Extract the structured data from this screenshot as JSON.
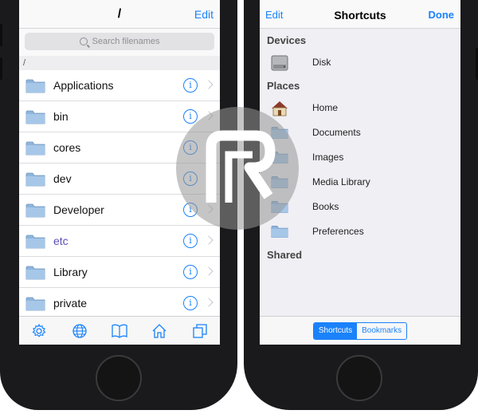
{
  "left_screen": {
    "nav_title": "/",
    "edit_label": "Edit",
    "search_placeholder": "Search filenames",
    "path": "/",
    "files": [
      {
        "name": "Applications",
        "style": "normal"
      },
      {
        "name": "bin",
        "style": "normal"
      },
      {
        "name": "cores",
        "style": "normal"
      },
      {
        "name": "dev",
        "style": "normal"
      },
      {
        "name": "Developer",
        "style": "normal"
      },
      {
        "name": "etc",
        "style": "link"
      },
      {
        "name": "Library",
        "style": "normal"
      },
      {
        "name": "private",
        "style": "normal"
      }
    ],
    "info_glyph": "i",
    "tabbar_icons": [
      "gear-icon",
      "globe-icon",
      "book-icon",
      "home-icon",
      "copy-icon"
    ]
  },
  "right_screen": {
    "edit_label": "Edit",
    "title": "Shortcuts",
    "done_label": "Done",
    "sections": {
      "devices": "Devices",
      "places": "Places",
      "shared": "Shared"
    },
    "devices": [
      {
        "label": "Disk",
        "icon": "disk-icon"
      }
    ],
    "places": [
      {
        "label": "Home",
        "icon": "house-icon"
      },
      {
        "label": "Documents",
        "icon": "folder-icon"
      },
      {
        "label": "Images",
        "icon": "folder-icon"
      },
      {
        "label": "Media Library",
        "icon": "folder-icon"
      },
      {
        "label": "Books",
        "icon": "folder-icon"
      },
      {
        "label": "Preferences",
        "icon": "folder-icon"
      }
    ],
    "segment": {
      "selected": "Shortcuts",
      "other": "Bookmarks"
    }
  },
  "colors": {
    "accent": "#1a82fb",
    "link_purple": "#5a4fb8",
    "folder_blue": "#8fb5dc",
    "phone_body": "#1a1a1c",
    "list_background": "#efeff4"
  }
}
